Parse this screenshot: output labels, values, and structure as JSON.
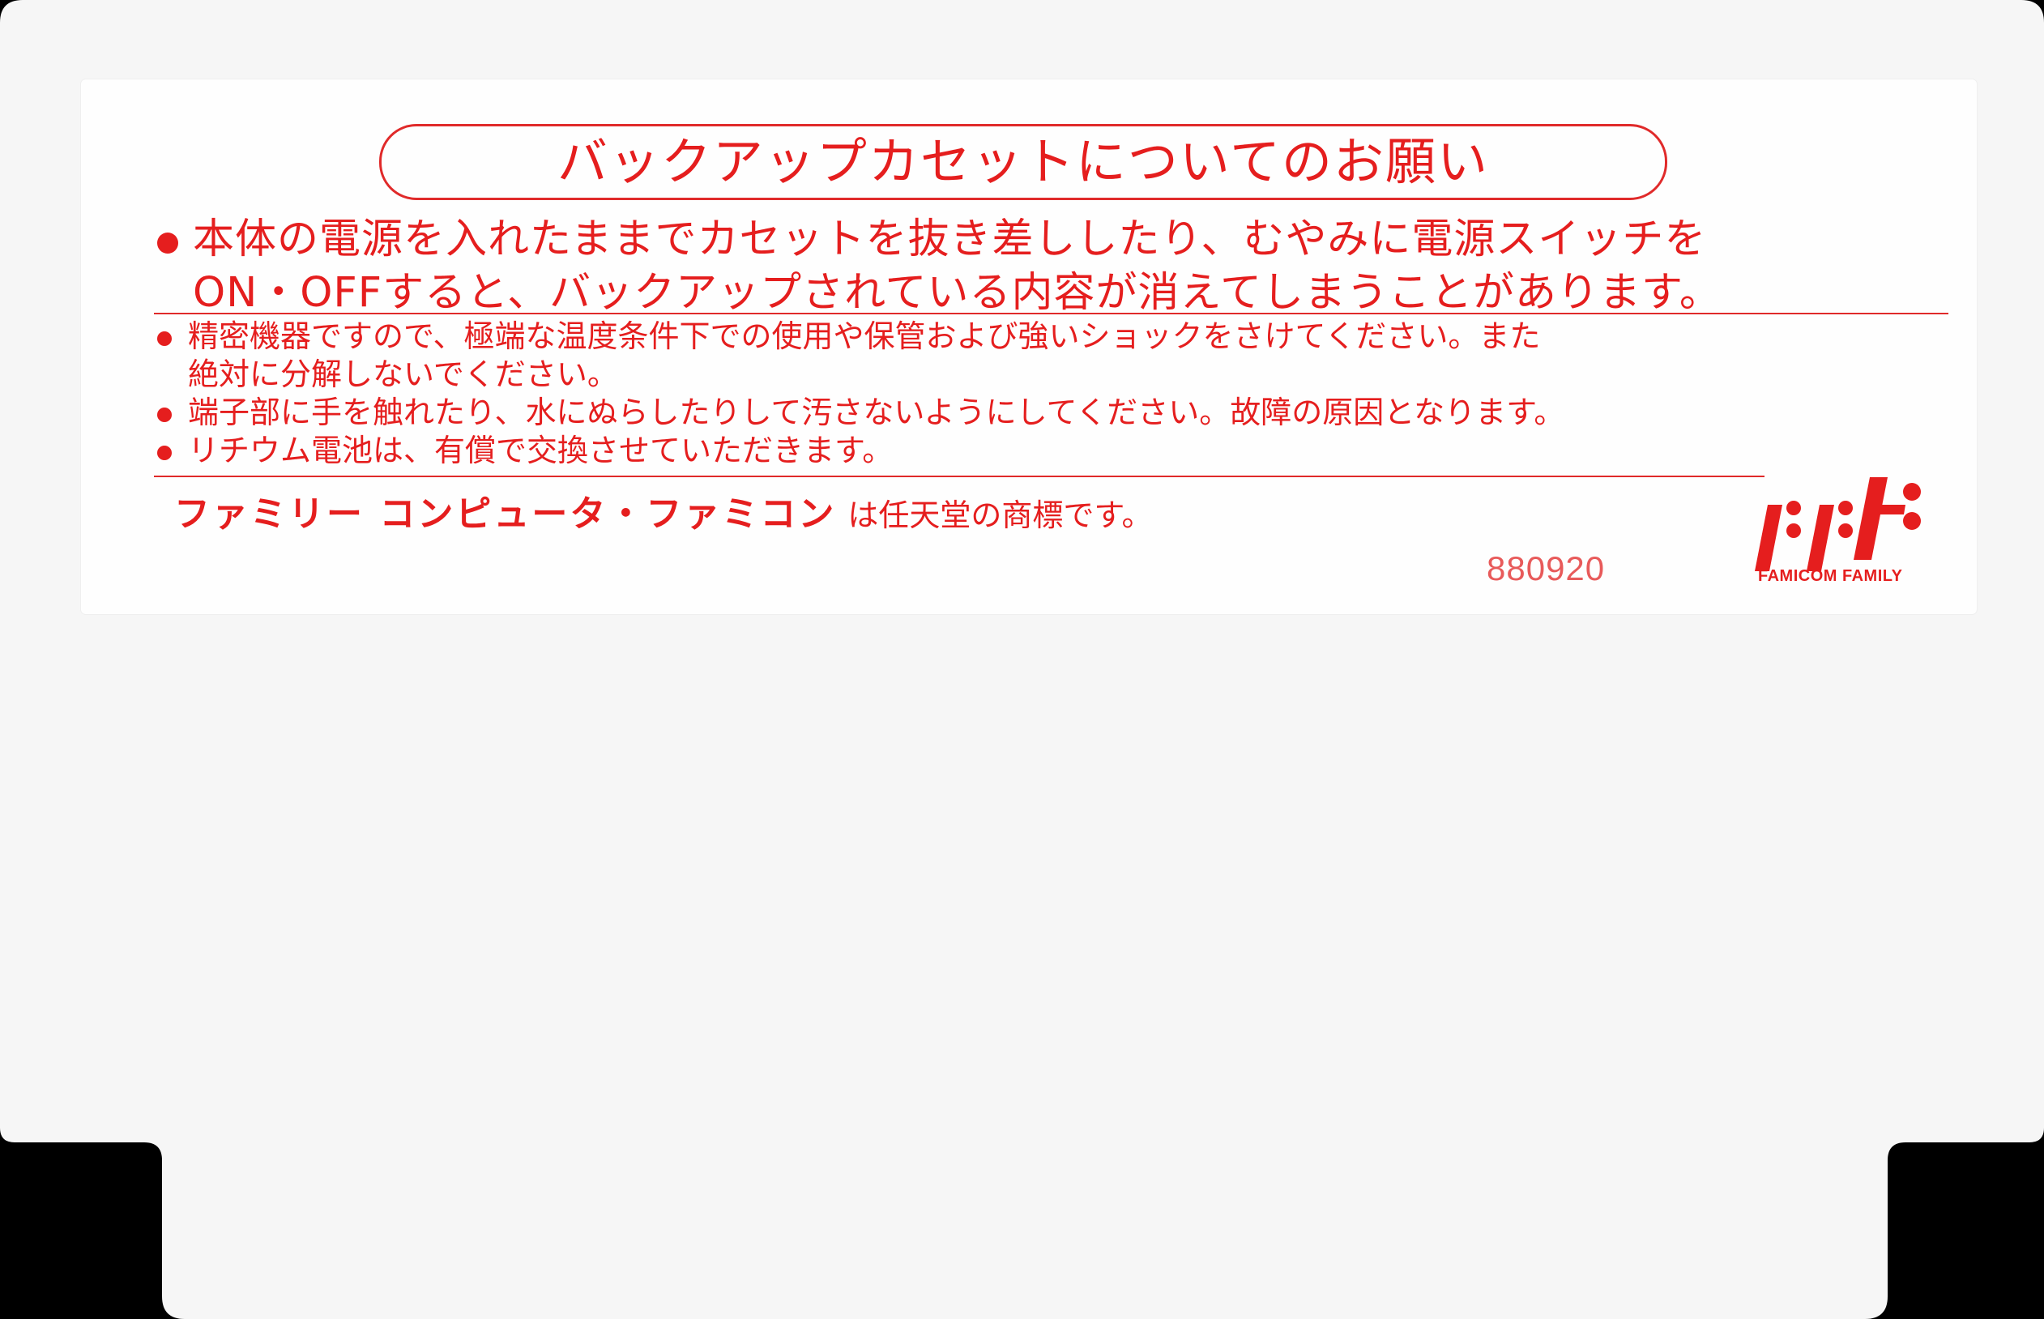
{
  "label": {
    "title": "バックアップカセットについてのお願い",
    "main_notice": {
      "line1": "本体の電源を入れたままでカセットを抜き差ししたり、むやみに電源スイッチを",
      "line2": "ON・OFFすると、バックアップされている内容が消えてしまうことがあります。"
    },
    "notes": [
      {
        "line1": "精密機器ですので、極端な温度条件下での使用や保管および強いショックをさけてください。また",
        "line2": "絶対に分解しないでください。"
      },
      {
        "line1": "端子部に手を触れたり、水にぬらしたりして汚さないようにしてください。故障の原因となります。"
      },
      {
        "line1": "リチウム電池は、有償で交換させていただきます。"
      }
    ],
    "trademark": {
      "brand": "ファミリー コンピュータ・ファミコン",
      "suffix": "は任天堂の商標です。"
    },
    "code": "880920",
    "logo_text": "FAMICOM FAMILY"
  },
  "colors": {
    "text_red": "#e51e1e",
    "cartridge": "#fefefe",
    "background": "#000000"
  }
}
